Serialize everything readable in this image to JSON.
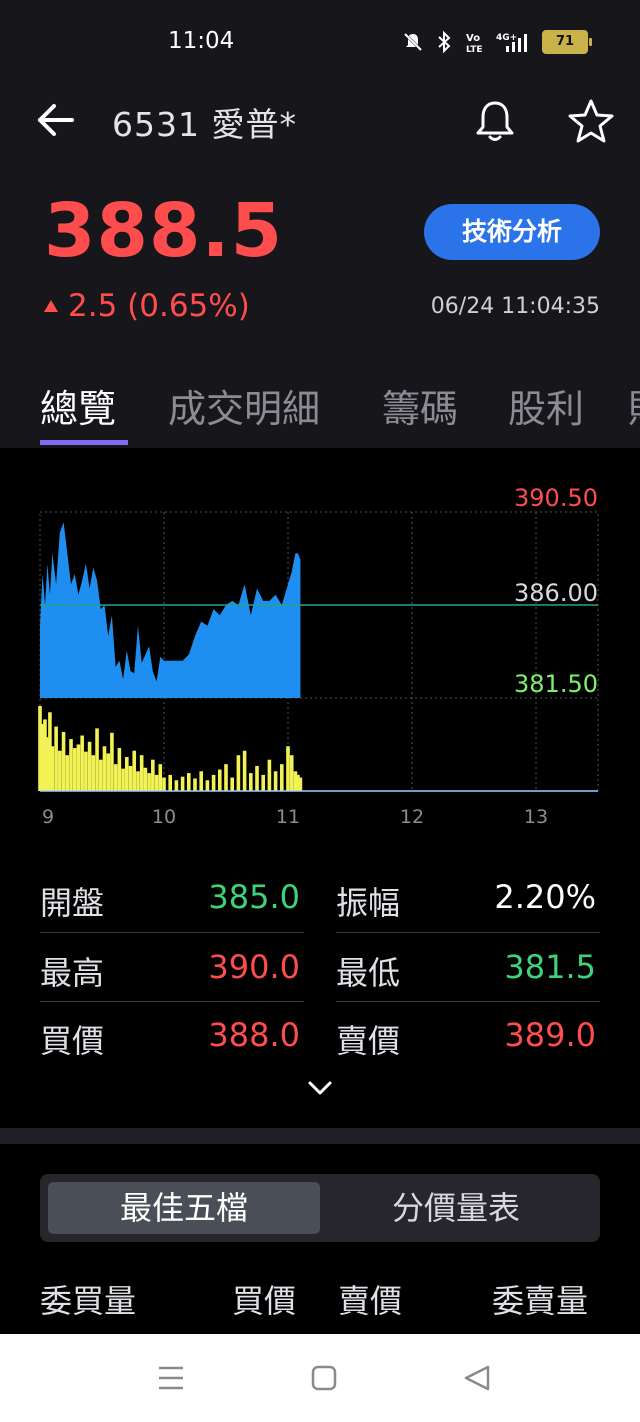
{
  "status_bar": {
    "time": "11:04",
    "battery": "71",
    "icons": [
      "mute-icon",
      "bluetooth-icon",
      "volte-icon",
      "4g-signal-icon",
      "battery-icon"
    ]
  },
  "header": {
    "title": "6531 愛普*",
    "icons": [
      "back-arrow-icon",
      "bell-icon",
      "star-icon"
    ]
  },
  "quote": {
    "price": "388.5",
    "change": "2.5 (0.65%)",
    "timestamp": "06/24 11:04:35",
    "technical_button": "技術分析",
    "color_up": "#ff4d4d"
  },
  "tabs": [
    "總覽",
    "成交明細",
    "籌碼",
    "股利",
    "財"
  ],
  "chart_data": {
    "type": "area",
    "title": "",
    "y_labels": [
      "390.50",
      "386.00",
      "381.50"
    ],
    "x_labels": [
      "9",
      "10",
      "11",
      "12",
      "13"
    ],
    "ylim": [
      381.5,
      390.5
    ],
    "reference_price": 386.0,
    "xlim": [
      9,
      13.5
    ],
    "price_series": {
      "color": "#1e8ef0",
      "x": [
        9.0,
        9.02,
        9.04,
        9.06,
        9.08,
        9.1,
        9.13,
        9.16,
        9.19,
        9.22,
        9.25,
        9.28,
        9.31,
        9.34,
        9.37,
        9.4,
        9.43,
        9.46,
        9.49,
        9.52,
        9.55,
        9.58,
        9.61,
        9.64,
        9.67,
        9.7,
        9.73,
        9.76,
        9.79,
        9.82,
        9.85,
        9.88,
        9.91,
        9.94,
        9.97,
        10.0,
        10.05,
        10.1,
        10.15,
        10.2,
        10.25,
        10.3,
        10.35,
        10.4,
        10.45,
        10.5,
        10.55,
        10.6,
        10.65,
        10.7,
        10.75,
        10.8,
        10.85,
        10.9,
        10.95,
        11.0,
        11.03,
        11.06,
        11.08,
        11.1
      ],
      "y": [
        385.0,
        387.5,
        386.0,
        388.0,
        386.5,
        388.5,
        387.0,
        389.5,
        390.0,
        388.5,
        387.0,
        387.5,
        386.5,
        387.2,
        388.0,
        386.8,
        387.8,
        387.2,
        385.8,
        386.0,
        384.5,
        385.5,
        383.0,
        383.3,
        382.4,
        383.8,
        382.8,
        382.7,
        385.0,
        383.2,
        383.6,
        384.0,
        382.8,
        382.3,
        383.5,
        383.3,
        383.3,
        383.3,
        383.3,
        383.6,
        384.5,
        385.2,
        385.0,
        385.8,
        385.5,
        386.0,
        386.2,
        386.0,
        387.0,
        385.5,
        386.8,
        386.2,
        386.2,
        386.5,
        386.0,
        387.0,
        387.6,
        388.5,
        388.5,
        388.2
      ]
    },
    "volume_series": {
      "color": "#f2f255",
      "x": [
        9.0,
        9.02,
        9.04,
        9.06,
        9.08,
        9.1,
        9.13,
        9.16,
        9.19,
        9.22,
        9.25,
        9.28,
        9.31,
        9.34,
        9.37,
        9.4,
        9.43,
        9.46,
        9.49,
        9.52,
        9.55,
        9.58,
        9.61,
        9.64,
        9.67,
        9.7,
        9.73,
        9.76,
        9.79,
        9.82,
        9.85,
        9.88,
        9.91,
        9.94,
        9.97,
        10.0,
        10.05,
        10.1,
        10.15,
        10.2,
        10.25,
        10.3,
        10.35,
        10.4,
        10.45,
        10.5,
        10.55,
        10.6,
        10.65,
        10.7,
        10.75,
        10.8,
        10.85,
        10.9,
        10.95,
        11.0,
        11.03,
        11.06,
        11.08,
        11.1
      ],
      "v": [
        95,
        75,
        80,
        60,
        88,
        50,
        72,
        45,
        66,
        40,
        58,
        48,
        52,
        62,
        44,
        55,
        40,
        70,
        35,
        50,
        42,
        65,
        30,
        48,
        25,
        38,
        28,
        45,
        22,
        40,
        26,
        20,
        35,
        18,
        30,
        15,
        18,
        12,
        16,
        20,
        14,
        22,
        12,
        18,
        24,
        30,
        15,
        40,
        45,
        20,
        28,
        18,
        35,
        22,
        30,
        50,
        40,
        22,
        18,
        15
      ]
    }
  },
  "stats": [
    {
      "label": "開盤",
      "value": "385.0",
      "color": "#3ed37a"
    },
    {
      "label": "振幅",
      "value": "2.20%",
      "color": "#ffffff"
    },
    {
      "label": "最高",
      "value": "390.0",
      "color": "#ff4d4d"
    },
    {
      "label": "最低",
      "value": "381.5",
      "color": "#3ed37a"
    },
    {
      "label": "買價",
      "value": "388.0",
      "color": "#ff4d4d"
    },
    {
      "label": "賣價",
      "value": "389.0",
      "color": "#ff4d4d"
    }
  ],
  "order_book": {
    "segments": [
      "最佳五檔",
      "分價量表"
    ],
    "headers": [
      "委買量",
      "買價",
      "賣價",
      "委賣量"
    ]
  },
  "nav": [
    "menu-icon",
    "home-icon",
    "back-icon"
  ]
}
